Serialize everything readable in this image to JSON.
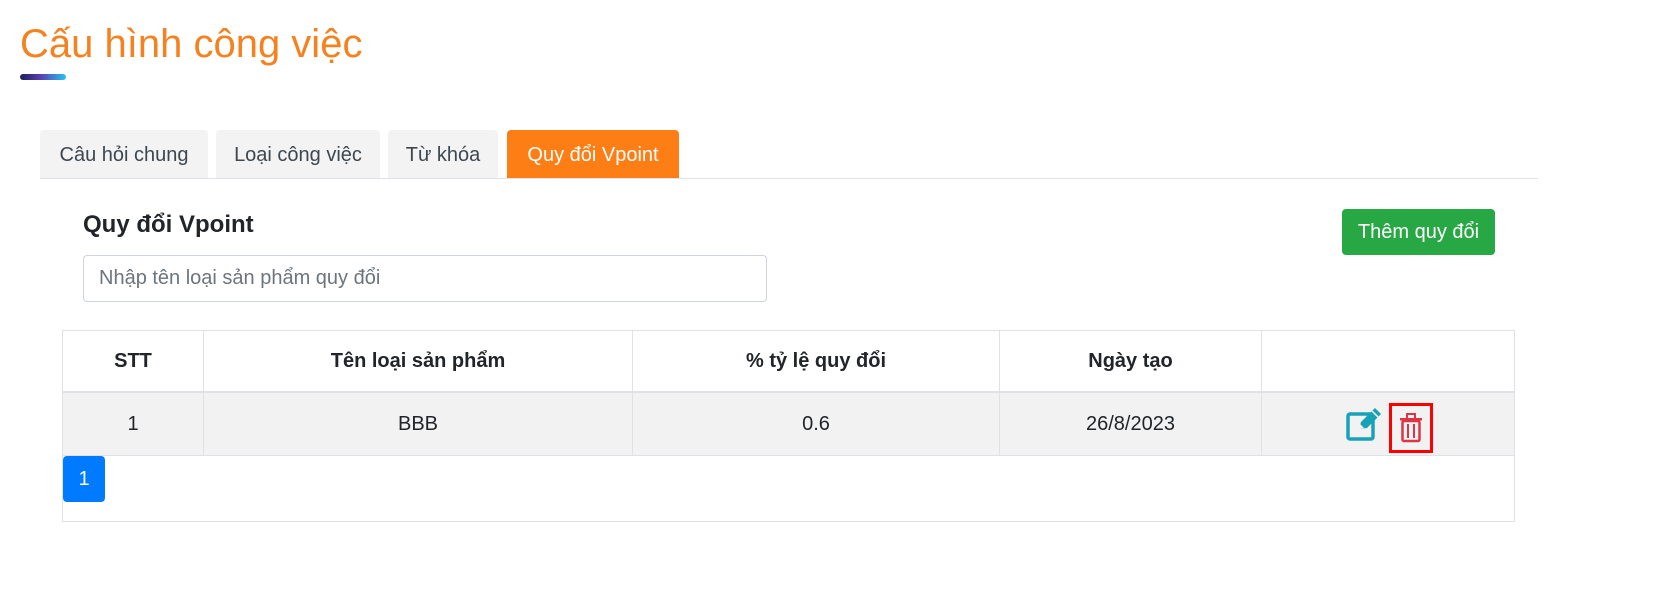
{
  "page": {
    "title": "Cấu hình công việc"
  },
  "tabs": [
    {
      "label": "Câu hỏi chung",
      "active": false
    },
    {
      "label": "Loại công việc",
      "active": false
    },
    {
      "label": "Từ khóa",
      "active": false
    },
    {
      "label": "Quy đổi Vpoint",
      "active": true
    }
  ],
  "section": {
    "title": "Quy đổi Vpoint",
    "add_button_label": "Thêm quy đổi",
    "search_placeholder": "Nhập tên loại sản phẩm quy đổi",
    "search_value": ""
  },
  "table": {
    "headers": [
      "STT",
      "Tên loại sản phẩm",
      "% tỷ lệ quy đổi",
      "Ngày tạo",
      ""
    ],
    "rows": [
      {
        "stt": "1",
        "name": "BBB",
        "rate": "0.6",
        "created": "26/8/2023",
        "actions": [
          "edit-icon",
          "trash-icon"
        ]
      }
    ]
  },
  "pagination": {
    "pages": [
      "1"
    ],
    "current": "1"
  },
  "colors": {
    "title": "#f58220",
    "active_tab": "#fd7e14",
    "add_button": "#28a745",
    "page_button": "#007bff",
    "edit_icon": "#17a2b8",
    "delete_icon": "#dc3545",
    "delete_highlight": "#ff0000"
  }
}
